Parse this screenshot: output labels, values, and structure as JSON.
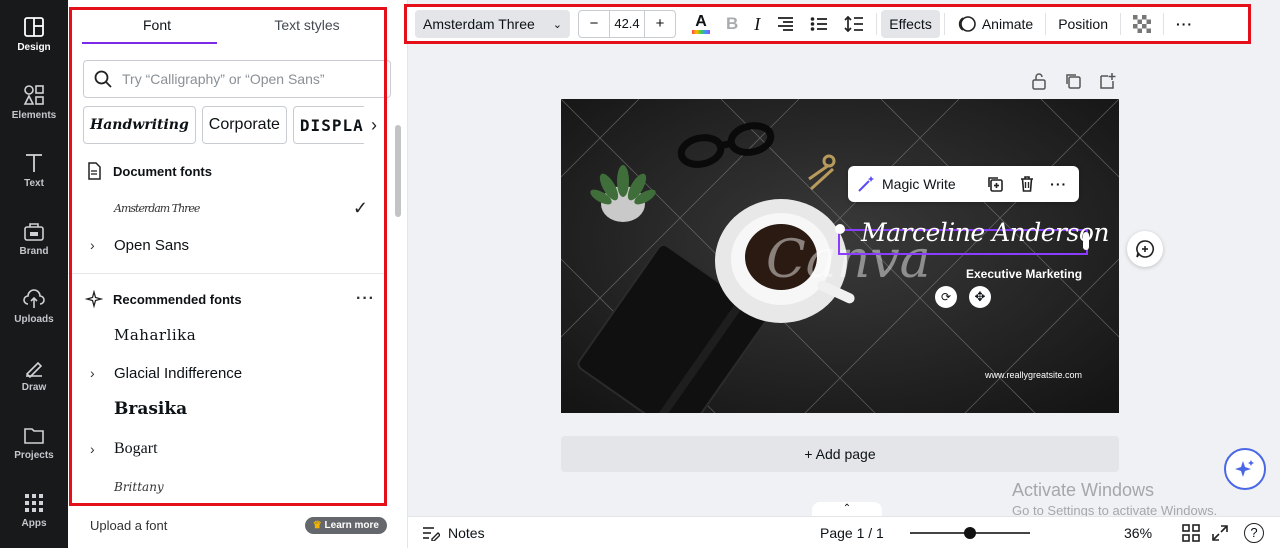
{
  "rail": [
    {
      "label": "Design",
      "icon": "design-icon",
      "active": true
    },
    {
      "label": "Elements",
      "icon": "elements-icon"
    },
    {
      "label": "Text",
      "icon": "text-icon"
    },
    {
      "label": "Brand",
      "icon": "brand-icon"
    },
    {
      "label": "Uploads",
      "icon": "uploads-icon"
    },
    {
      "label": "Draw",
      "icon": "draw-icon"
    },
    {
      "label": "Projects",
      "icon": "projects-icon"
    },
    {
      "label": "Apps",
      "icon": "apps-icon"
    }
  ],
  "panel": {
    "tabs": [
      "Font",
      "Text styles"
    ],
    "search_placeholder": "Try “Calligraphy” or “Open Sans”",
    "chips": [
      "Handwriting",
      "Corporate",
      "DISPLAY"
    ],
    "document_fonts_title": "Document fonts",
    "document_fonts": [
      "Amsterdam Three",
      "Open Sans"
    ],
    "recommended_title": "Recommended fonts",
    "recommended": [
      "Maharlika",
      "Glacial Indifference",
      "Brasika",
      "Bogart",
      "Brittany"
    ],
    "upload_label": "Upload a font",
    "learn_more": "Learn more"
  },
  "toolbar": {
    "font_name": "Amsterdam Three",
    "minus": "−",
    "font_size": "42.4",
    "plus": "+",
    "bold": "B",
    "italic": "I",
    "effects": "Effects",
    "animate": "Animate",
    "position": "Position"
  },
  "design": {
    "name": "Marceline Anderson",
    "subtitle": "Executive Marketing",
    "website": "www.reallygreatsite.com",
    "watermark": "Canva"
  },
  "context_menu": {
    "magic_write": "Magic Write"
  },
  "add_page": "+ Add page",
  "bottom": {
    "notes": "Notes",
    "page": "Page 1 / 1",
    "zoom": "36%",
    "zoom_level": 0.5
  },
  "windows_watermark": {
    "line1": "Activate Windows",
    "line2": "Go to Settings to activate Windows."
  },
  "colors": {
    "accent": "#7d2ae8",
    "highlight": "#e3101a",
    "rail": "#18191b"
  }
}
